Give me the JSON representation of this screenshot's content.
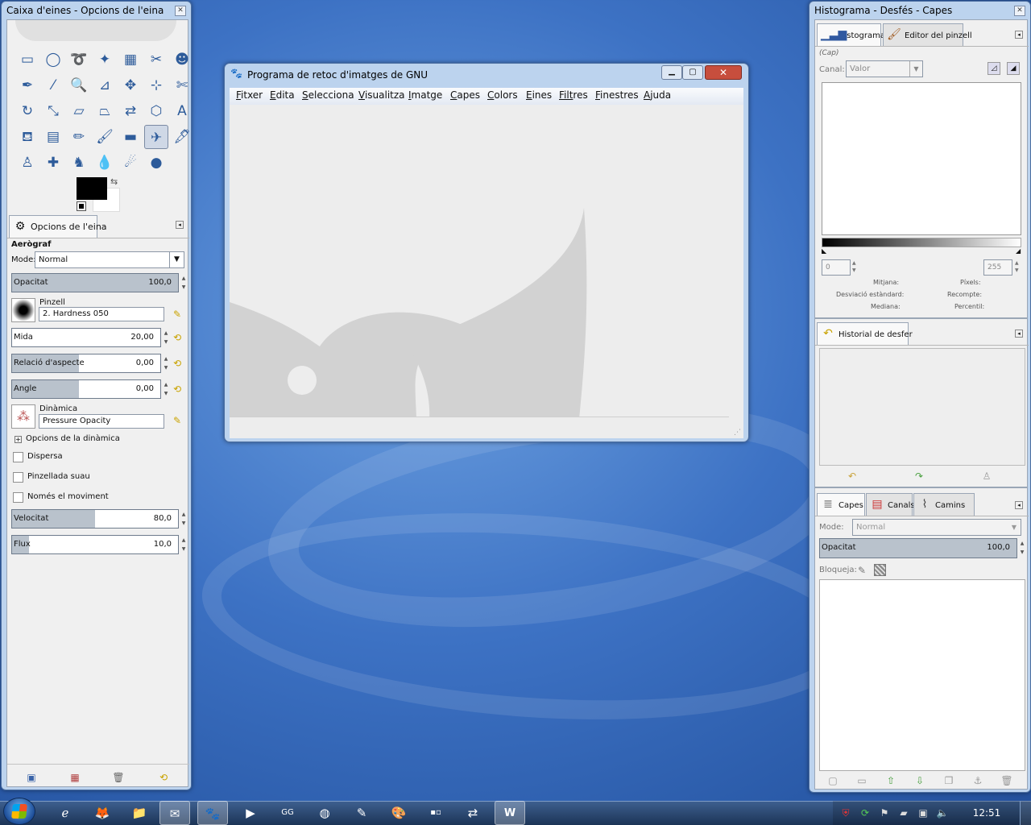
{
  "toolbox": {
    "title": "Caixa d'eines - Opcions de l'eina",
    "close": "✕",
    "tools": [
      {
        "name": "rect-select-icon",
        "glyph": "▭"
      },
      {
        "name": "ellipse-select-icon",
        "glyph": "◯"
      },
      {
        "name": "free-select-icon",
        "glyph": "➰"
      },
      {
        "name": "fuzzy-select-icon",
        "glyph": "✦"
      },
      {
        "name": "color-select-icon",
        "glyph": "▦"
      },
      {
        "name": "scissors-icon",
        "glyph": "✂"
      },
      {
        "name": "foreground-select-icon",
        "glyph": "☻"
      },
      {
        "name": "paths-icon",
        "glyph": "✒"
      },
      {
        "name": "color-picker-icon",
        "glyph": "⁄"
      },
      {
        "name": "zoom-icon",
        "glyph": "🔍"
      },
      {
        "name": "measure-icon",
        "glyph": "⊿"
      },
      {
        "name": "move-icon",
        "glyph": "✥"
      },
      {
        "name": "align-icon",
        "glyph": "⊹"
      },
      {
        "name": "crop-icon",
        "glyph": "✄"
      },
      {
        "name": "rotate-icon",
        "glyph": "↻"
      },
      {
        "name": "scale-icon",
        "glyph": "⤡"
      },
      {
        "name": "shear-icon",
        "glyph": "▱"
      },
      {
        "name": "perspective-icon",
        "glyph": "⏢"
      },
      {
        "name": "flip-icon",
        "glyph": "⇄"
      },
      {
        "name": "cage-icon",
        "glyph": "⬡"
      },
      {
        "name": "text-icon",
        "glyph": "A"
      },
      {
        "name": "bucket-fill-icon",
        "glyph": "⛾"
      },
      {
        "name": "blend-icon",
        "glyph": "▤"
      },
      {
        "name": "pencil-icon",
        "glyph": "✏"
      },
      {
        "name": "paintbrush-icon",
        "glyph": "🖌"
      },
      {
        "name": "eraser-icon",
        "glyph": "▬"
      },
      {
        "name": "airbrush-icon",
        "glyph": "✈"
      },
      {
        "name": "ink-icon",
        "glyph": "🖋"
      },
      {
        "name": "clone-icon",
        "glyph": "♙"
      },
      {
        "name": "heal-icon",
        "glyph": "✚"
      },
      {
        "name": "perspective-clone-icon",
        "glyph": "♞"
      },
      {
        "name": "blur-icon",
        "glyph": "💧"
      },
      {
        "name": "smudge-icon",
        "glyph": "☄"
      },
      {
        "name": "dodge-burn-icon",
        "glyph": "●"
      }
    ],
    "selected_tool": 26,
    "tool_options_tab": "Opcions de l'eina",
    "tool_name": "Aerògraf",
    "mode_label": "Mode:",
    "mode_value": "Normal",
    "opacity": {
      "label": "Opacitat",
      "value": "100,0",
      "fraction": 1.0
    },
    "brush_label": "Pinzell",
    "brush_value": "2. Hardness 050",
    "size": {
      "label": "Mida",
      "value": "20,00",
      "fraction": 0.0
    },
    "aspect": {
      "label": "Relació d'aspecte",
      "value": "0,00",
      "fraction": 0.45
    },
    "angle": {
      "label": "Angle",
      "value": "0,00",
      "fraction": 0.45
    },
    "dynamics_label": "Dinàmica",
    "dynamics_value": "Pressure Opacity",
    "dynamics_options": "Opcions de la dinàmica",
    "checks": [
      "Dispersa",
      "Pinzellada suau",
      "Només el moviment"
    ],
    "rate": {
      "label": "Velocitat",
      "value": "80,0",
      "fraction": 0.5
    },
    "flow": {
      "label": "Flux",
      "value": "10,0",
      "fraction": 0.1
    }
  },
  "main": {
    "title": "Programa de retoc d'imatges de GNU",
    "menu": [
      [
        "F",
        "itxer"
      ],
      [
        "E",
        "dita"
      ],
      [
        "S",
        "elecciona"
      ],
      [
        "V",
        "isualitza"
      ],
      [
        "I",
        "matge"
      ],
      [
        "C",
        "apes"
      ],
      [
        "C",
        "olors"
      ],
      [
        "E",
        "ines"
      ],
      [
        "Filt",
        "res"
      ],
      [
        "F",
        "inestres"
      ],
      [
        "A",
        "juda"
      ]
    ]
  },
  "docks": {
    "title": "Histograma - Desfés - Capes",
    "tab_histogram": "Histograma",
    "tab_brush_editor": "Editor del pinzell",
    "layer_none": "(Cap)",
    "channel_label": "Canal:",
    "channel_value": "Valor",
    "range_min": "0",
    "range_max": "255",
    "stats": [
      "Mitjana:",
      "Desviació estàndard:",
      "Mediana:",
      "Píxels:",
      "Recompte:",
      "Percentil:"
    ],
    "tab_undo": "Historial de desfer",
    "tab_layers": "Capes",
    "tab_channels": "Canals",
    "tab_paths": "Camins",
    "layers_mode_label": "Mode:",
    "layers_mode_value": "Normal",
    "layers_opacity": {
      "label": "Opacitat",
      "value": "100,0",
      "fraction": 1.0
    },
    "lock_label": "Bloqueja:"
  },
  "taskbar": {
    "clock": "12:51"
  }
}
